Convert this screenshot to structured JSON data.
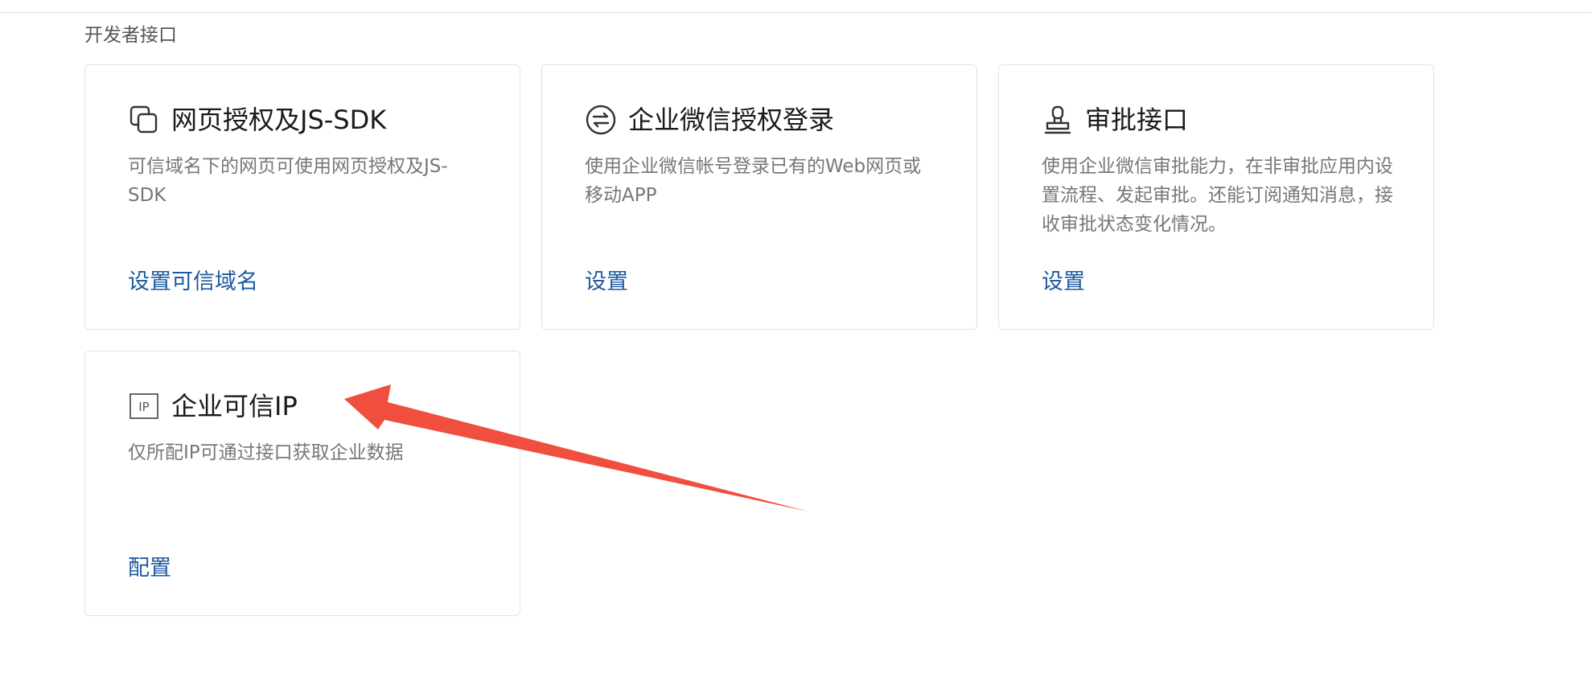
{
  "section": {
    "title": "开发者接口"
  },
  "cards": [
    {
      "icon": "copy-squares-icon",
      "title": "网页授权及JS-SDK",
      "desc": "可信域名下的网页可使用网页授权及JS-SDK",
      "link": "设置可信域名"
    },
    {
      "icon": "exchange-circle-icon",
      "title": "企业微信授权登录",
      "desc": "使用企业微信帐号登录已有的Web网页或移动APP",
      "link": "设置"
    },
    {
      "icon": "stamp-icon",
      "title": "审批接口",
      "desc": "使用企业微信审批能力，在非审批应用内设置流程、发起审批。还能订阅通知消息，接收审批状态变化情况。",
      "link": "设置"
    },
    {
      "icon": "ip-box-icon",
      "icon_text": "IP",
      "title": "企业可信IP",
      "desc": "仅所配IP可通过接口获取企业数据",
      "link": "配置"
    }
  ],
  "colors": {
    "link": "#1e5aa0",
    "annotation_arrow": "#f04e3e"
  }
}
